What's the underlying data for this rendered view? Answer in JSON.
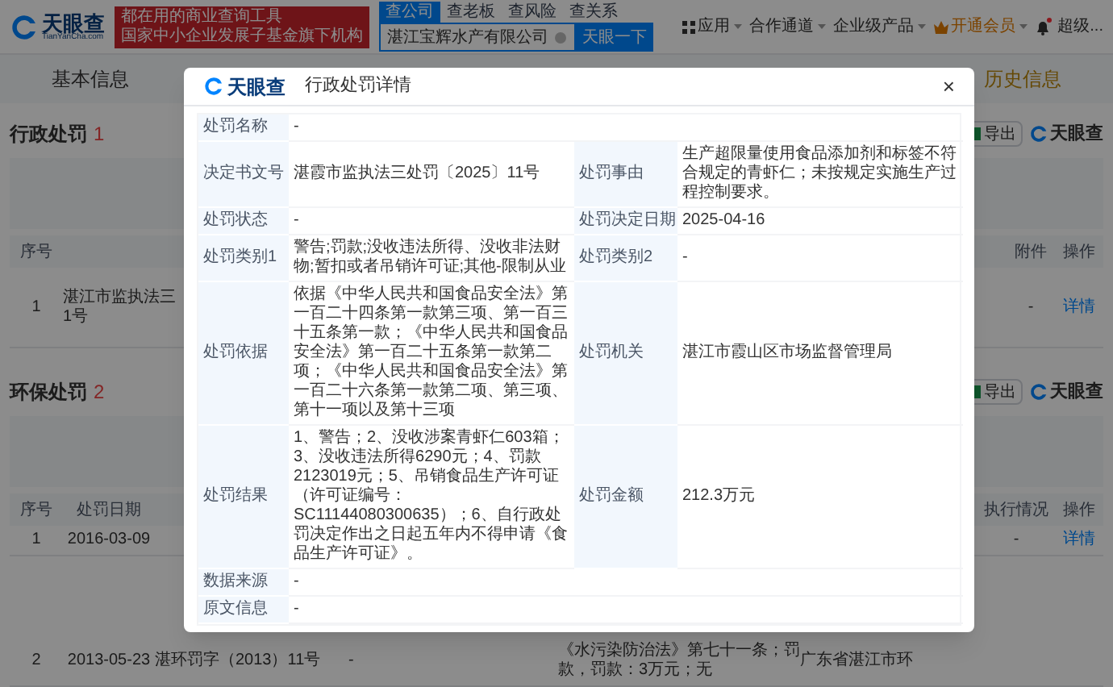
{
  "header": {
    "logo": "天眼查",
    "logo_domain": "TianYanCha.com",
    "banner_lines": [
      "都在用的商业查询工具",
      "国家中小企业发展子基金旗下机构"
    ],
    "search_tabs": [
      {
        "label": "查公司",
        "selected": true
      },
      {
        "label": "查老板",
        "selected": false
      },
      {
        "label": "查风险",
        "selected": false
      },
      {
        "label": "查关系",
        "selected": false
      }
    ],
    "search": {
      "value": "湛江宝辉水产有限公司"
    },
    "search_button": "天眼一下",
    "menu": [
      {
        "kind": "apps",
        "label": "应用"
      },
      {
        "kind": "plain",
        "label": "合作通道"
      },
      {
        "kind": "plain",
        "label": "企业级产品"
      },
      {
        "kind": "vip",
        "label": "开通会员"
      }
    ],
    "notification": {
      "unread": true
    },
    "user": "超级..."
  },
  "nav_tabs": [
    {
      "label": "基本信息",
      "selected": false
    },
    {
      "label": "历史信息",
      "selected": false
    }
  ],
  "sections": [
    {
      "title": "行政处罚",
      "count": "1",
      "export": "导出",
      "brand": "天眼查",
      "columns": [
        "序号",
        "",
        "附件",
        "操作"
      ],
      "rows": [
        {
          "cells": [
            {
              "text": "1"
            },
            {
              "text": "湛江市监执法三\n1号"
            },
            {
              "text": "-"
            },
            {
              "text": "详情",
              "kind": "link"
            }
          ]
        }
      ]
    },
    {
      "title": "环保处罚",
      "count": "2",
      "export": "导出",
      "brand": "天眼查",
      "columns": [
        "序号",
        "处罚日期",
        "",
        "",
        "",
        "",
        "执行情况",
        "操作"
      ],
      "rows": [
        {
          "cells": [
            {
              "text": "1"
            },
            {
              "text": "2016-03-09"
            },
            {
              "text": ""
            },
            {
              "text": ""
            },
            {
              "text": ""
            },
            {
              "text": ""
            },
            {
              "text": "-"
            },
            {
              "text": "详情",
              "kind": "link"
            }
          ]
        },
        {
          "cells": [
            {
              "text": "2"
            },
            {
              "text": "2013-05-23"
            },
            {
              "text": "湛环罚字（2013）11号"
            },
            {
              "text": "-"
            },
            {
              "text": "《水污染防治法》第七十一条；罚款，罚款：3万元；无"
            },
            {
              "text": "广东省湛江市环"
            }
          ]
        }
      ]
    }
  ],
  "dialog": {
    "logo": "天眼查",
    "title": "行政处罚详情",
    "close": "×",
    "rows": [
      [
        {
          "label": "处罚名称",
          "value": "-"
        }
      ],
      [
        {
          "label": "决定书文号",
          "value": "湛霞市监执法三处罚〔2025〕11号"
        },
        {
          "label": "处罚事由",
          "value": "生产超限量使用食品添加剂和标签不符合规定的青虾仁；未按规定实施生产过程控制要求。"
        }
      ],
      [
        {
          "label": "处罚状态",
          "value": "-"
        },
        {
          "label": "处罚决定日期",
          "value": "2025-04-16"
        }
      ],
      [
        {
          "label": "处罚类别1",
          "value": "警告;罚款;没收违法所得、没收非法财物;暂扣或者吊销许可证;其他-限制从业"
        },
        {
          "label": "处罚类别2",
          "value": "-"
        }
      ],
      [
        {
          "label": "处罚依据",
          "value": "依据《中华人民共和国食品安全法》第一百二十四条第一款第三项、第一百三十五条第一款；《中华人民共和国食品安全法》第一百二十五条第一款第二项；《中华人民共和国食品安全法》第一百二十六条第一款第二项、第三项、第十一项以及第十三项"
        },
        {
          "label": "处罚机关",
          "value": "湛江市霞山区市场监督管理局"
        }
      ],
      [
        {
          "label": "处罚结果",
          "value": "1、警告；2、没收涉案青虾仁603箱；3、没收违法所得6290元；4、罚款2123019元；5、吊销食品生产许可证（许可证编号：SC11144080300635）；6、自行政处罚决定作出之日起五年内不得申请《食品生产许可证》。"
        },
        {
          "label": "处罚金额",
          "value": "212.3万元"
        }
      ],
      [
        {
          "label": "数据来源",
          "value": "-"
        }
      ],
      [
        {
          "label": "原文信息",
          "value": "-"
        }
      ]
    ]
  }
}
